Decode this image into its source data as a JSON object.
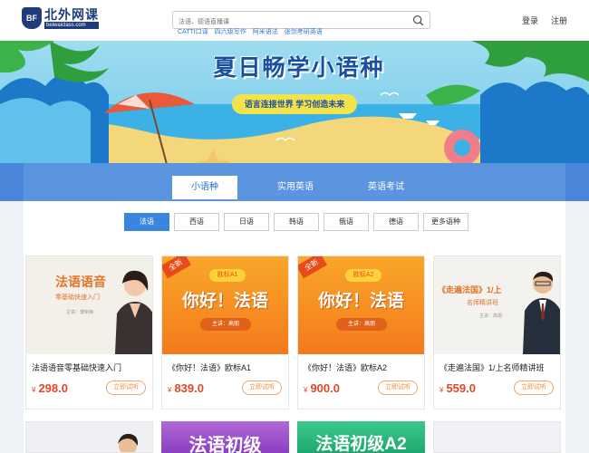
{
  "header": {
    "logo_badge": "BF",
    "logo_title": "北外网课",
    "logo_sub": "beiwaiclass.com",
    "search_placeholder": "法语、德语直播课",
    "hot_links": [
      "CATTI口译",
      "四六级写作",
      "阿米语法",
      "张剑考研英语"
    ],
    "login": "登录",
    "register": "注册"
  },
  "banner": {
    "title": "夏日畅学小语种",
    "subtitle": "语言连接世界  学习创造未来"
  },
  "tabs": [
    {
      "label": "小语种",
      "active": true
    },
    {
      "label": "实用英语",
      "active": false
    },
    {
      "label": "英语考试",
      "active": false
    }
  ],
  "languages": [
    "法语",
    "西语",
    "日语",
    "韩语",
    "俄语",
    "德语",
    "更多语种"
  ],
  "active_language": "法语",
  "courses": [
    {
      "thumb_title": "法语语音",
      "thumb_sub": "零基础快速入门",
      "thumb_teacher": "主讲：傅荣梅",
      "title": "法语语音零基础快速入门",
      "price": "298.0",
      "button": "立即试听"
    },
    {
      "thumb_title": "你好！法语",
      "thumb_level": "欧标A1",
      "thumb_tag": "全新",
      "thumb_teacher": "主讲：高朋",
      "title": "《你好！法语》欧标A1",
      "price": "839.0",
      "button": "立即试听"
    },
    {
      "thumb_title": "你好！法语",
      "thumb_level": "欧标A2",
      "thumb_tag": "全新",
      "thumb_teacher": "主讲：高朋",
      "title": "《你好！法语》欧标A2",
      "price": "900.0",
      "button": "立即试听"
    },
    {
      "thumb_title": "《走遍法国》1/上",
      "thumb_sub": "名师精讲班",
      "thumb_teacher": "主讲：高朋",
      "title": "《走遍法国》1/上名师精讲班",
      "price": "559.0",
      "button": "立即试听"
    }
  ],
  "row2": [
    {
      "thumb_title": ""
    },
    {
      "thumb_title": "法语初级"
    },
    {
      "thumb_title": "法语初级A2"
    },
    {
      "thumb_title": ""
    }
  ],
  "currency": "¥",
  "colors": {
    "accent": "#3a86de",
    "price": "#e3472a",
    "orange": "#f7931e"
  }
}
